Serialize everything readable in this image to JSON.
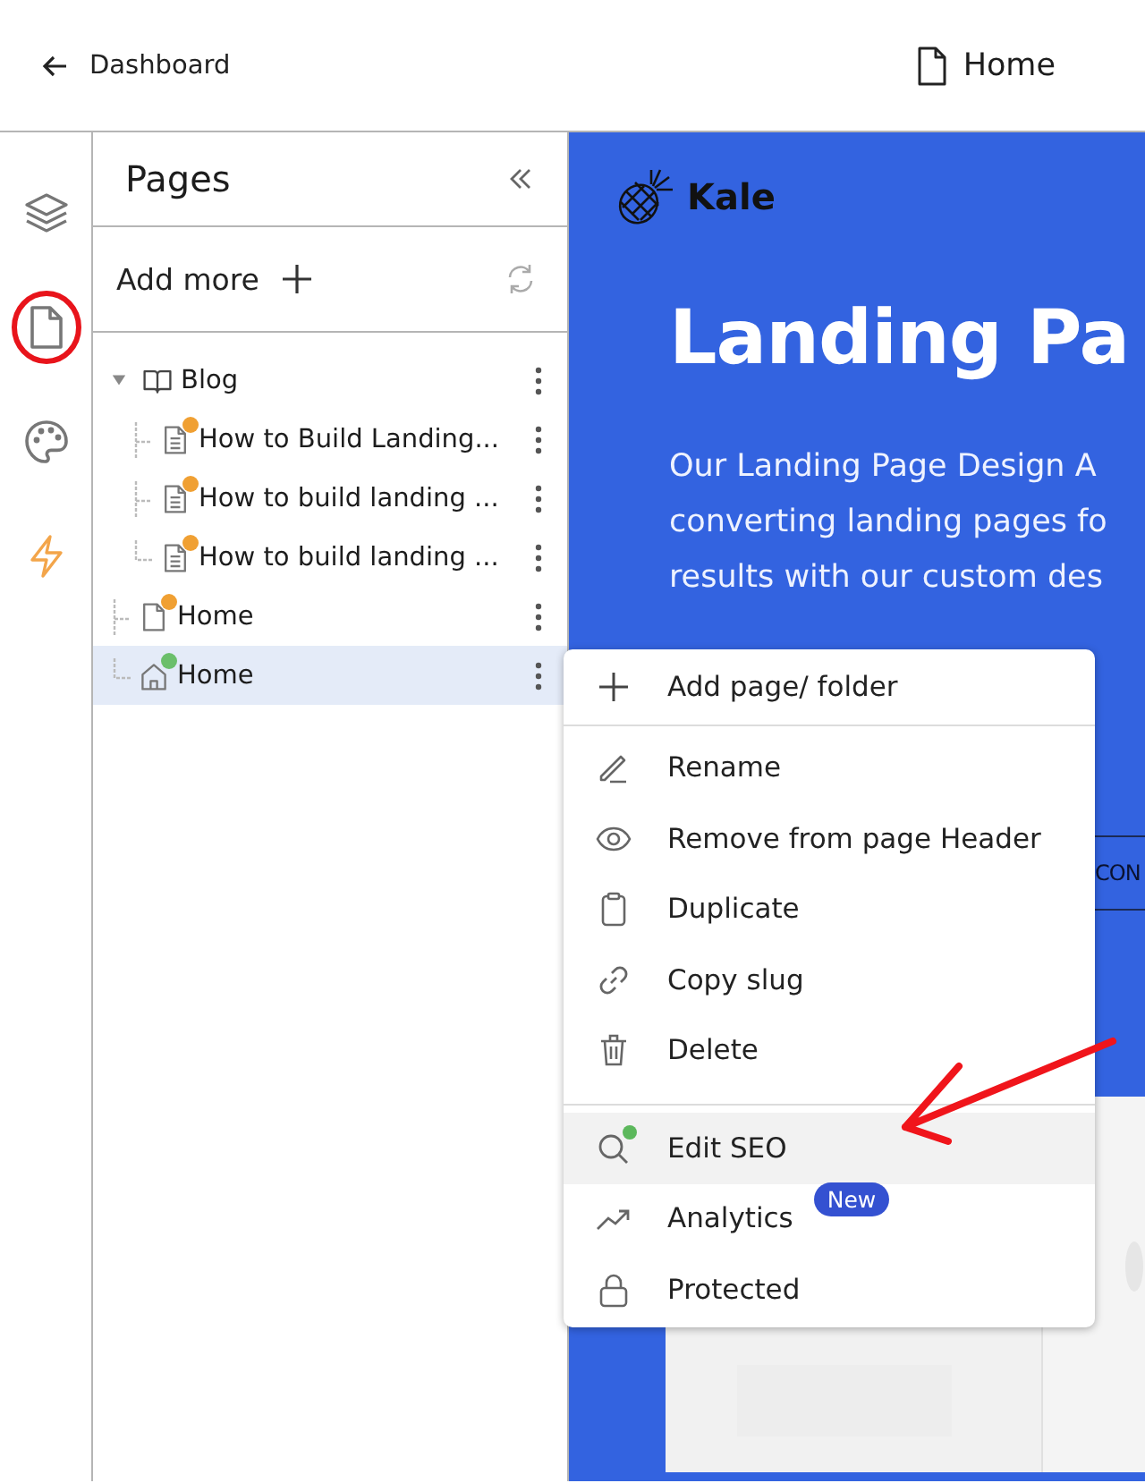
{
  "top_bar": {
    "back_label": "Dashboard",
    "page_title": "Home"
  },
  "pages_panel": {
    "title": "Pages",
    "add_label": "Add more",
    "tree": [
      {
        "label": "Blog",
        "kind": "folder",
        "expanded": true,
        "selected": false,
        "children": [
          {
            "label": "How to Build Landing...",
            "kind": "post",
            "color": "#f0a033",
            "selected": false
          },
          {
            "label": "How to build landing ...",
            "kind": "post",
            "color": "#f0a033",
            "selected": false
          },
          {
            "label": "How to build landing ...",
            "kind": "post",
            "color": "#f0a033",
            "selected": false
          }
        ]
      },
      {
        "label": "Home",
        "kind": "page",
        "color": "#f0a033",
        "selected": false
      },
      {
        "label": "Home",
        "kind": "home",
        "color": "#6bbf6b",
        "selected": true
      }
    ]
  },
  "preview": {
    "brand": "Kale",
    "heading": "Landing Pa",
    "paragraph_lines": [
      "Our Landing Page Design A",
      "converting landing pages fo",
      "results with our custom des"
    ],
    "button_label": "CON"
  },
  "context_menu": {
    "groups": [
      [
        {
          "label": "Add page/ folder",
          "kind": "add",
          "highlighted": false
        }
      ],
      [
        {
          "label": "Rename",
          "kind": "rename",
          "highlighted": false
        },
        {
          "label": "Remove from page Header",
          "kind": "visibility",
          "highlighted": false
        },
        {
          "label": "Duplicate",
          "kind": "duplicate",
          "highlighted": false
        },
        {
          "label": "Copy slug",
          "kind": "link",
          "highlighted": false
        },
        {
          "label": "Delete",
          "kind": "delete",
          "highlighted": false
        }
      ],
      [
        {
          "label": "Edit SEO",
          "kind": "seo",
          "highlighted": true,
          "color": "#5cb85c"
        },
        {
          "label": "Analytics",
          "kind": "analytics",
          "highlighted": false,
          "badge": "New"
        },
        {
          "label": "Protected",
          "kind": "lock",
          "highlighted": false
        }
      ]
    ]
  }
}
